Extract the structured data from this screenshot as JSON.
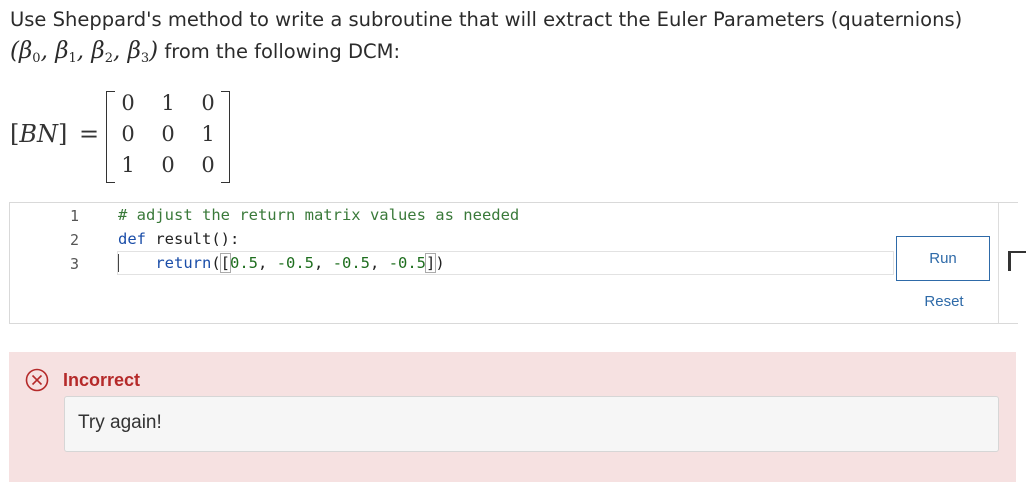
{
  "question": {
    "line1": "Use Sheppard's method to write a subroutine that will extract the Euler Parameters (quaternions)",
    "params_math": "(β₀, β₁, β₂, β₃)",
    "line2_suffix": "from the following DCM:",
    "lhs": "[BN]",
    "equals": "=",
    "matrix": [
      [
        "0",
        "1",
        "0"
      ],
      [
        "0",
        "0",
        "1"
      ],
      [
        "1",
        "0",
        "0"
      ]
    ]
  },
  "editor": {
    "line_numbers": [
      "1",
      "2",
      "3"
    ],
    "lines": {
      "comment": "# adjust the return matrix values as needed",
      "def_kw": "def",
      "def_rest": " result():",
      "ret_kw": "return",
      "paren_open": "(",
      "bracket_open": "[",
      "v1": "0.5",
      "sep1": ", ",
      "v2": "-0.5",
      "sep2": ", ",
      "v3": "-0.5",
      "sep3": ", ",
      "v4": "-0.5",
      "bracket_close": "]",
      "paren_close": ")"
    },
    "run_label": "Run",
    "reset_label": "Reset"
  },
  "feedback": {
    "status": "Incorrect",
    "message": "Try again!",
    "color": "#b52a2a",
    "background": "#f6e1e1",
    "icon": "x-circle-icon"
  }
}
